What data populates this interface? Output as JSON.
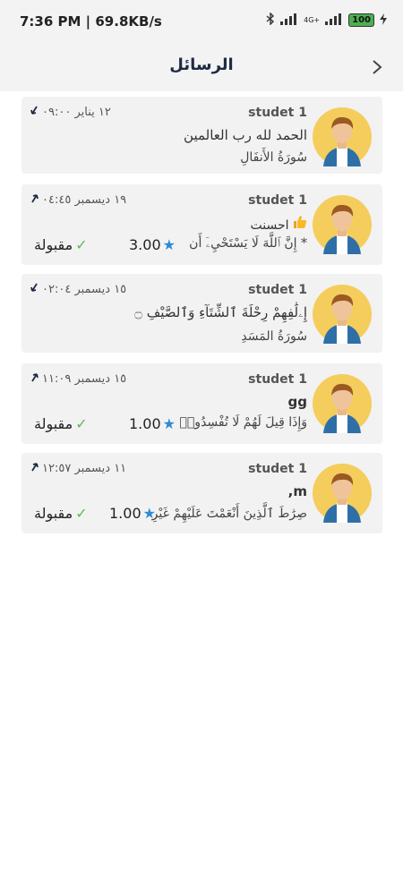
{
  "status": {
    "time": "7:36 PM | 69.8KB/s",
    "network": "4G+",
    "battery": "100"
  },
  "header": {
    "title": "الرسائل"
  },
  "messages": [
    {
      "sender": "studet 1",
      "date": "١٢ يناير ٠٩:٠٠",
      "direction": "down",
      "line1": "الحمد لله رب العالمين",
      "line2": "سُورَةُ الأَنفَالِ"
    },
    {
      "sender": "studet 1",
      "date": "١٩ ديسمبر ٠٤:٤٥",
      "direction": "up",
      "line1": "احسنت",
      "line2": "* إِنَّ ٱللَّهَ لَا يَسْتَحْيِۦٓ أَن",
      "rating": "3.00",
      "status": "مقبولة"
    },
    {
      "sender": "studet 1",
      "date": "١٥ ديسمبر ٠٢:٠٤",
      "direction": "down",
      "line1": "إِۦلَٰفِهِمْ رِحْلَةَ ٱلشِّتَآءِ وَٱلصَّيْفِ ۝",
      "line2": "سُورَةُ المَسَدِ"
    },
    {
      "sender": "studet 1",
      "date": "١٥ ديسمبر ١١:٠٩",
      "direction": "up",
      "line1": "gg",
      "line2": "وَإِذَا قِيلَ لَهُمْ لَا تُفْسِدُوا۟",
      "rating": "1.00",
      "status": "مقبولة"
    },
    {
      "sender": "studet 1",
      "date": "١١ ديسمبر ١٢:٥٧",
      "direction": "up",
      "line1": "m,",
      "line2": "صِرَٰطَ ٱلَّذِينَ أَنْعَمْتَ عَلَيْهِمْ غَيْرِ",
      "rating": "1.00",
      "status": "مقبولة"
    }
  ]
}
